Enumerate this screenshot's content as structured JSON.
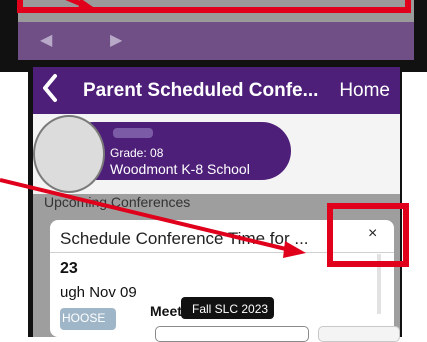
{
  "top_frame": {
    "back_arrow": "◀",
    "forward_arrow": "▶"
  },
  "header": {
    "back_icon": "chevron-left-icon",
    "title": "Parent Scheduled Confe...",
    "home_label": "Home",
    "color": "#4e1f79"
  },
  "student": {
    "grade": "Grade: 08",
    "school": "Woodmont K-8 School"
  },
  "section": {
    "upcoming_label": "Upcoming Conferences"
  },
  "modal": {
    "title": "Schedule Conference Time for ...",
    "close_label": "×",
    "event_number": "23",
    "event_dates": "ugh Nov 09",
    "choose_label": "HOOSE",
    "meet_label": "Meet",
    "tooltip": "Fall SLC 2023"
  },
  "annotations": {
    "highlight_color": "#e0001b"
  }
}
